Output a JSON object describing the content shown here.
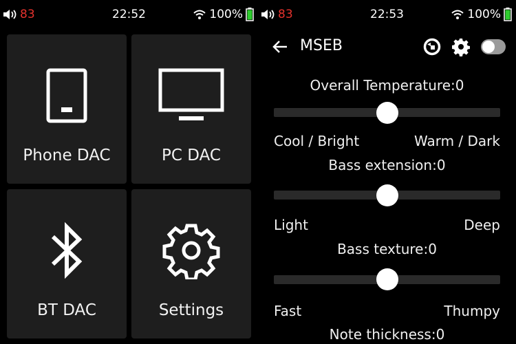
{
  "left_screen": {
    "status": {
      "volume_icon": "volume-icon",
      "volume_level": "83",
      "time": "22:52",
      "battery": "100%"
    },
    "tiles": [
      {
        "label": "Phone DAC",
        "icon": "phone-icon"
      },
      {
        "label": "PC DAC",
        "icon": "monitor-icon"
      },
      {
        "label": "BT DAC",
        "icon": "bluetooth-icon"
      },
      {
        "label": "Settings",
        "icon": "gear-icon"
      }
    ]
  },
  "right_screen": {
    "status": {
      "volume_icon": "volume-icon",
      "volume_level": "83",
      "time": "22:53",
      "battery": "100%"
    },
    "header": {
      "title": "MSEB",
      "icons": [
        "back-arrow-icon",
        "reset-icon",
        "gear-icon",
        "toggle-switch"
      ],
      "toggle_on": false
    },
    "params": [
      {
        "title": "Overall Temperature:0",
        "value": 0,
        "min_label": "Cool / Bright",
        "max_label": "Warm / Dark"
      },
      {
        "title": "Bass extension:0",
        "value": 0,
        "min_label": "Light",
        "max_label": "Deep"
      },
      {
        "title": "Bass texture:0",
        "value": 0,
        "min_label": "Fast",
        "max_label": "Thumpy"
      },
      {
        "title": "Note thickness:0",
        "value": 0
      }
    ]
  },
  "colors": {
    "background": "#000000",
    "tile": "#1e1e1e",
    "volume_number": "#e5322d",
    "battery_fill": "#2ecc2e",
    "track": "#2a2a2a"
  }
}
